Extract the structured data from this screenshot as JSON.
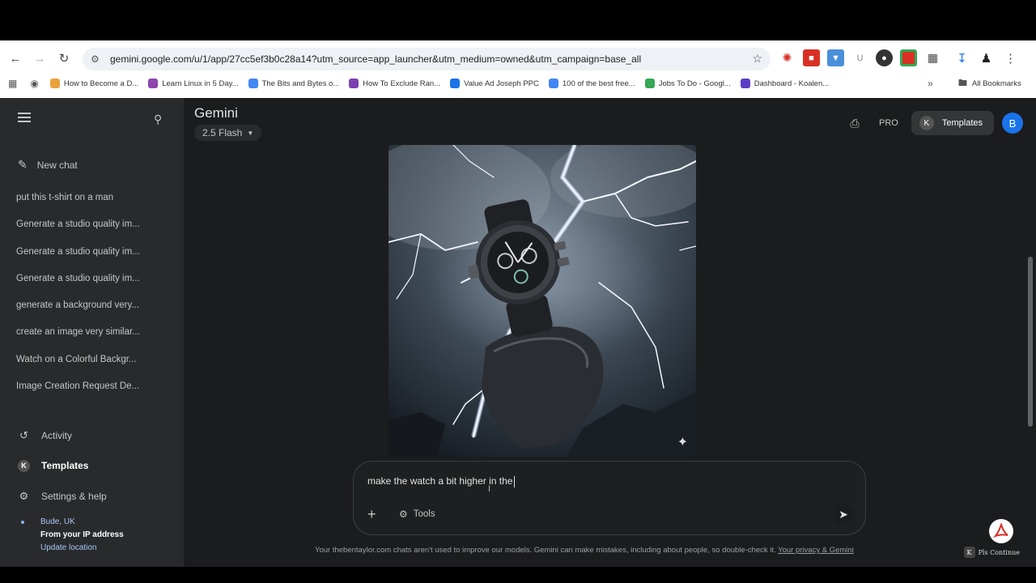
{
  "browser": {
    "url": "gemini.google.com/u/1/app/27cc5ef3b0c28a14?utm_source=app_launcher&utm_medium=owned&utm_campaign=base_all",
    "bookmarks": [
      {
        "label": "How to Become a D...",
        "color": "#e8a23b"
      },
      {
        "label": "Learn Linux in 5 Day...",
        "color": "#8e44ad"
      },
      {
        "label": "The Bits and Bytes o...",
        "color": "#4285f4"
      },
      {
        "label": "How To Exclude Ran...",
        "color": "#7b3fb0"
      },
      {
        "label": "Value Ad Joseph PPC",
        "color": "#1a73e8"
      },
      {
        "label": "100 of the best free...",
        "color": "#4285f4"
      },
      {
        "label": "Jobs To Do - Googl...",
        "color": "#34a853"
      },
      {
        "label": "Dashboard - Koalen...",
        "color": "#5b3cc4"
      }
    ],
    "all_bookmarks": "All Bookmarks"
  },
  "app": {
    "title": "Gemini",
    "model": "2.5 Flash",
    "pro_label": "PRO",
    "templates_button": "Templates",
    "templates_k": "K",
    "avatar_letter": "B"
  },
  "sidebar": {
    "new_chat": "New chat",
    "recent": [
      "put this t-shirt on a man",
      "Generate a studio quality im...",
      "Generate a studio quality im...",
      "Generate a studio quality im...",
      "generate a background very...",
      "create an image very similar...",
      "Watch on a Colorful Backgr...",
      "Image Creation Request De..."
    ],
    "activity": "Activity",
    "templates": "Templates",
    "settings": "Settings & help",
    "location_city": "Bude, UK",
    "location_source": "From your IP address",
    "update_location": "Update location"
  },
  "prompt": {
    "text": "make the watch a bit higher in the",
    "tools": "Tools"
  },
  "footer": {
    "disclaimer": "Your thebentaylor.com chats aren't used to improve our models. Gemini can make mistakes, including about people, so double-check it.",
    "privacy_link": "Your privacy & Gemini",
    "pls_continue": "Pls Continue"
  }
}
